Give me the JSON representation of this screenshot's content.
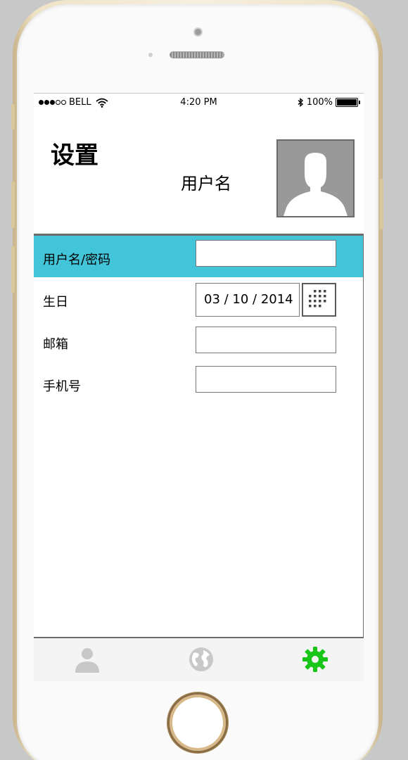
{
  "status_bar": {
    "carrier": "BELL",
    "time": "4:20 PM",
    "battery": "100%",
    "signal_bars_filled": 3,
    "signal_bars_total": 5,
    "icons": [
      "wifi-icon",
      "bluetooth-icon",
      "battery-icon"
    ]
  },
  "header": {
    "title": "设置",
    "username": "用户名",
    "avatar_icon": "person-silhouette-icon"
  },
  "form": {
    "fields": [
      {
        "label": "用户名/密码",
        "value": "",
        "highlighted": true
      },
      {
        "label": "生日",
        "value": "03 / 10 / 2014",
        "type": "date"
      },
      {
        "label": "邮箱",
        "value": ""
      },
      {
        "label": "手机号",
        "value": ""
      }
    ],
    "highlight_color": "#43c5d9",
    "date_picker_icon": "grid-icon"
  },
  "tab_bar": {
    "tabs": [
      {
        "icon": "person-icon",
        "active": false
      },
      {
        "icon": "globe-icon",
        "active": false
      },
      {
        "icon": "gear-icon",
        "active": true
      }
    ],
    "active_color": "#19c519",
    "inactive_color": "#c8c8c8"
  }
}
